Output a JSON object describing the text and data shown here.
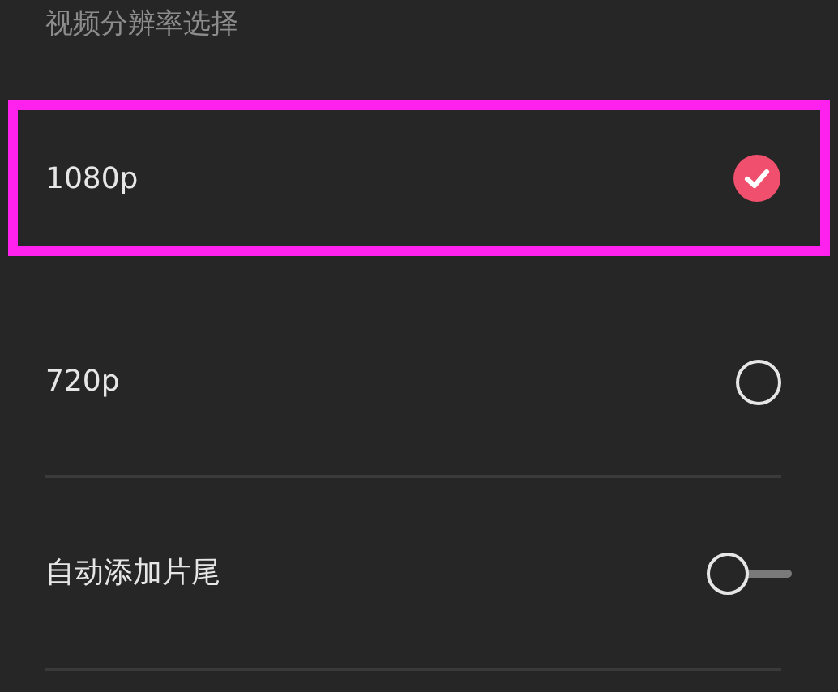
{
  "section_title": "视频分辨率选择",
  "options": [
    {
      "kind": "radio",
      "label": "1080p",
      "selected": true,
      "highlighted": true
    },
    {
      "kind": "radio",
      "label": "720p",
      "selected": false,
      "highlighted": false
    },
    {
      "kind": "toggle",
      "label": "自动添加片尾",
      "on": false,
      "highlighted": false
    }
  ]
}
